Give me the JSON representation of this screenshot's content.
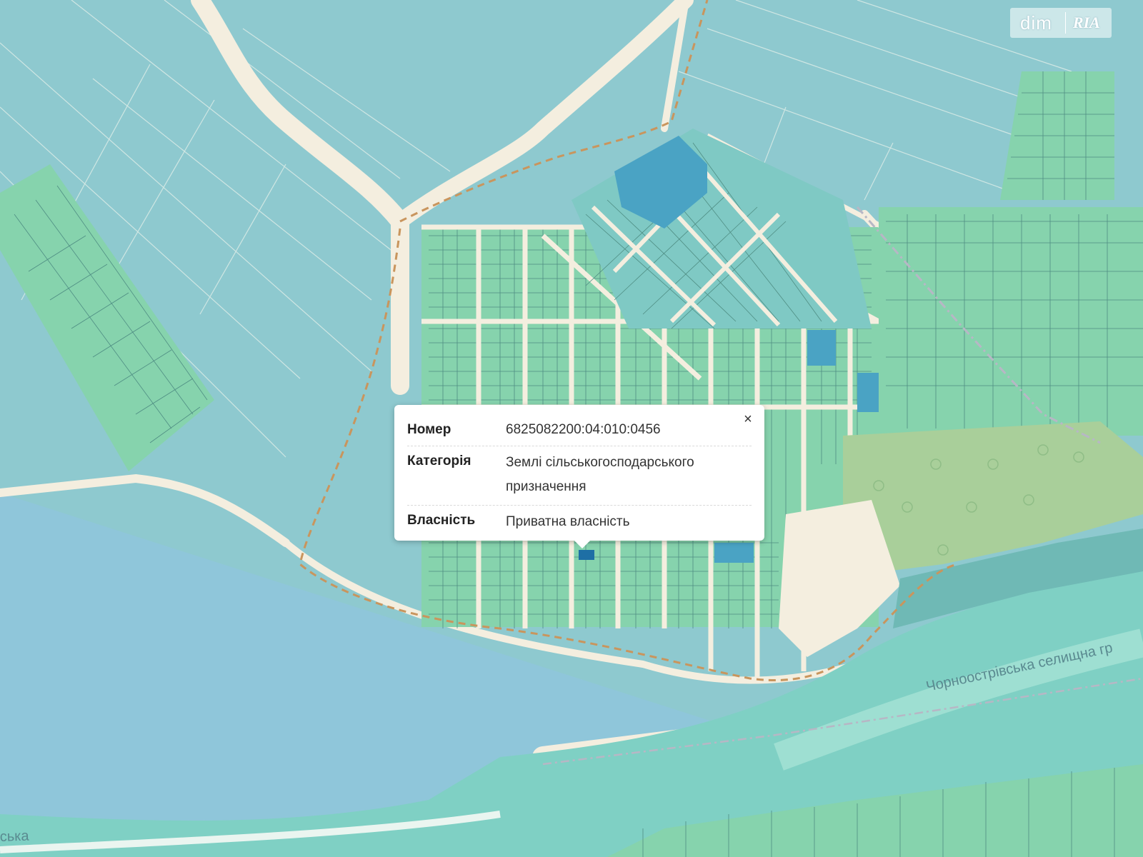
{
  "popup": {
    "rows": [
      {
        "key": "Номер",
        "value": "6825082200:04:010:0456"
      },
      {
        "key": "Категорія",
        "value": "Землі сільськогосподарського призначення"
      },
      {
        "key": "Власність",
        "value": "Приватна власність"
      }
    ],
    "close_label": "×"
  },
  "logo": {
    "left": "dim",
    "right": "RIA"
  },
  "map_labels": {
    "admin_boundary": "Чорноострівська селищна гр",
    "river_fragment": "ська"
  },
  "colors": {
    "field": "#8ec9cf",
    "parcel_green": "#86d3ad",
    "parcel_teal": "#7fc4c2",
    "parcel_dark": "#4aa3c4",
    "road": "#f4eedf",
    "forest": "#a9cf9a",
    "water": "#7fd0c4",
    "boundary": "#c9955d"
  }
}
